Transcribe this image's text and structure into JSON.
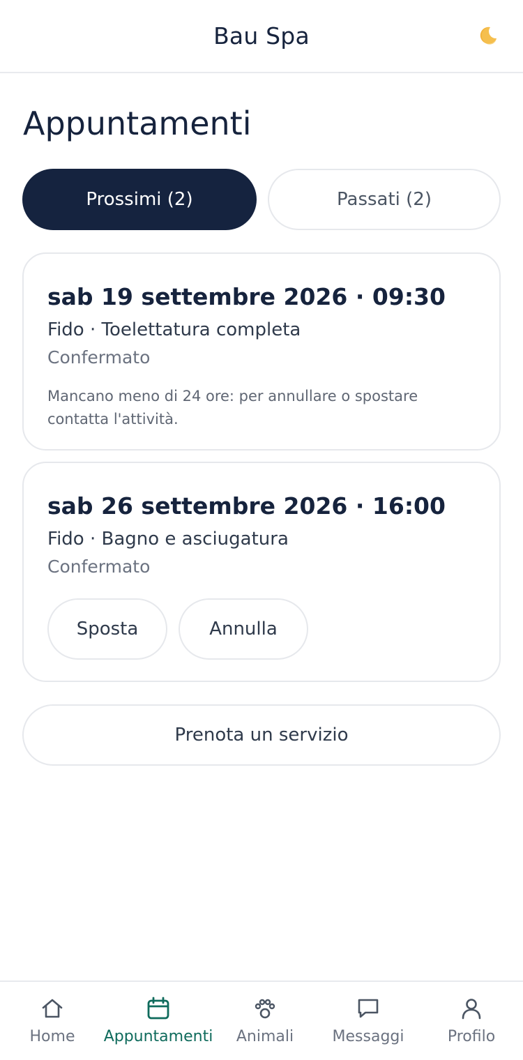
{
  "header": {
    "title": "Bau Spa",
    "theme_icon": "moon-icon"
  },
  "page": {
    "title": "Appuntamenti"
  },
  "tabs": [
    {
      "label": "Prossimi (2)",
      "active": true
    },
    {
      "label": "Passati (2)",
      "active": false
    }
  ],
  "appointments": [
    {
      "date": "sab 19 settembre 2026 · 09:30",
      "service": "Fido · Toelettatura completa",
      "status": "Confermato",
      "note": "Mancano meno di 24 ore: per annullare o spostare contatta l'attività."
    },
    {
      "date": "sab 26 settembre 2026 · 16:00",
      "service": "Fido · Bagno e asciugatura",
      "status": "Confermato",
      "actions": {
        "reschedule": "Sposta",
        "cancel": "Annulla"
      }
    }
  ],
  "book_button": "Prenota un servizio",
  "nav": [
    {
      "label": "Home",
      "icon": "home-icon",
      "active": false
    },
    {
      "label": "Appuntamenti",
      "icon": "calendar-icon",
      "active": true
    },
    {
      "label": "Animali",
      "icon": "paw-icon",
      "active": false
    },
    {
      "label": "Messaggi",
      "icon": "chat-icon",
      "active": false
    },
    {
      "label": "Profilo",
      "icon": "user-icon",
      "active": false
    }
  ],
  "colors": {
    "primary": "#15233f",
    "accent": "#0f6b5c",
    "border": "#e6e8ec",
    "muted": "#6b7280"
  }
}
